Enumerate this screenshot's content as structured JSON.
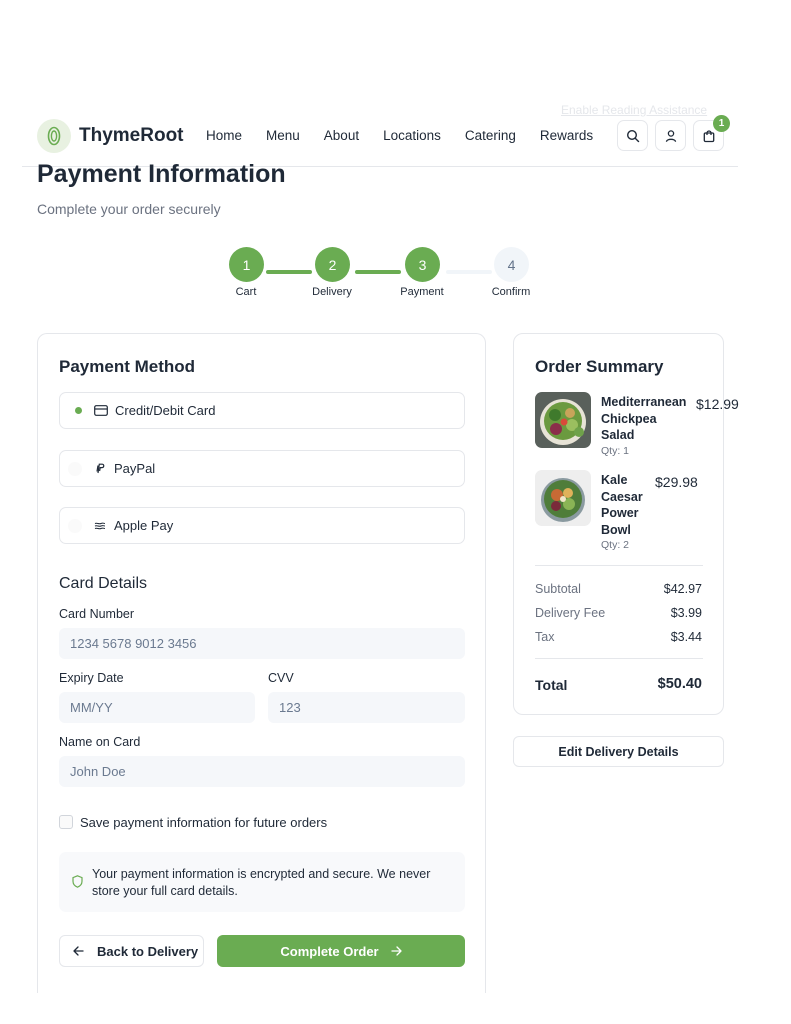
{
  "accessibility": {
    "link_text": "Enable Reading Assistance"
  },
  "header": {
    "brand": "ThymeRoot",
    "nav": [
      "Home",
      "Menu",
      "About",
      "Locations",
      "Catering",
      "Rewards"
    ],
    "icons": {
      "search": "search-icon",
      "account": "user-icon",
      "cart": "shopping-bag-icon"
    },
    "cart_count": "1"
  },
  "page": {
    "title": "Payment Information",
    "subtitle": "Complete your order securely"
  },
  "steps": [
    {
      "number": "1",
      "label": "Cart",
      "status": "complete"
    },
    {
      "number": "2",
      "label": "Delivery",
      "status": "complete"
    },
    {
      "number": "3",
      "label": "Payment",
      "status": "current"
    },
    {
      "number": "4",
      "label": "Confirm",
      "status": "upcoming"
    }
  ],
  "payment": {
    "title": "Payment Method",
    "methods": [
      {
        "label": "Credit/Debit Card",
        "icon": "credit-card-icon",
        "selected": true
      },
      {
        "label": "PayPal",
        "icon": "paypal-icon",
        "selected": false
      },
      {
        "label": "Apple Pay",
        "icon": "apple-pay-icon",
        "selected": false
      }
    ],
    "card_details_title": "Card Details",
    "card_number": {
      "label": "Card Number",
      "placeholder": "1234 5678 9012 3456",
      "value": ""
    },
    "expiry": {
      "label": "Expiry Date",
      "placeholder": "MM/YY",
      "value": ""
    },
    "cvv": {
      "label": "CVV",
      "placeholder": "123",
      "value": ""
    },
    "name": {
      "label": "Name on Card",
      "placeholder": "John Doe",
      "value": ""
    },
    "save_label": "Save payment information for future orders",
    "save_checked": false,
    "secure_note": "Your payment information is encrypted and secure. We never store your full card details.",
    "back_label": "Back to Delivery",
    "complete_label": "Complete Order"
  },
  "summary": {
    "title": "Order Summary",
    "items": [
      {
        "name_lines": [
          "Mediterranean",
          "Chickpea",
          "Salad"
        ],
        "qty": "Qty: 1",
        "price": "$12.99"
      },
      {
        "name_lines": [
          "Kale",
          "Caesar",
          "Power",
          "Bowl"
        ],
        "qty": "Qty: 2",
        "price": "$29.98"
      }
    ],
    "subtotal_label": "Subtotal",
    "subtotal": "$42.97",
    "delivery_label": "Delivery Fee",
    "delivery": "$3.99",
    "tax_label": "Tax",
    "tax": "$3.44",
    "total_label": "Total",
    "total": "$50.40"
  },
  "edit_delivery_label": "Edit Delivery Details",
  "colors": {
    "accent": "#6aac52",
    "text": "#1f2937",
    "muted": "#6b7280",
    "border": "#e5e7eb",
    "field_bg": "#f5f7fa"
  }
}
